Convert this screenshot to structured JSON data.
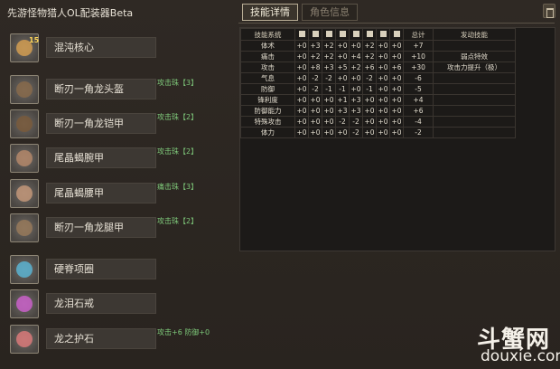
{
  "app": {
    "title": "先游怪物猎人OL配装器Beta"
  },
  "tabs": [
    {
      "label": "技能详情",
      "active": true
    },
    {
      "label": "角色信息",
      "active": false
    }
  ],
  "equipment": [
    {
      "name": "混沌核心",
      "level": "15",
      "note": "",
      "icon": "weapon-icon",
      "color": "#d8a050"
    },
    {
      "name": "断刃一角龙头盔",
      "note": "攻击珠【3】",
      "icon": "helmet-icon",
      "color": "#8a6a4a"
    },
    {
      "name": "断刃一角龙铠甲",
      "note": "攻击珠【2】",
      "icon": "chest-armor-icon",
      "color": "#7a5a3a"
    },
    {
      "name": "尾晶蝎腕甲",
      "note": "攻击珠【2】",
      "icon": "gauntlet-icon",
      "color": "#b88a6a"
    },
    {
      "name": "尾晶蝎腰甲",
      "note": "痛击珠【3】",
      "icon": "waist-armor-icon",
      "color": "#c89a7a"
    },
    {
      "name": "断刃一角龙腿甲",
      "note": "攻击珠【2】",
      "icon": "leg-armor-icon",
      "color": "#9a7a5a"
    },
    {
      "name": "硬脊项圈",
      "note": "",
      "icon": "necklace-icon",
      "color": "#5ab8d8"
    },
    {
      "name": "龙泪石戒",
      "note": "",
      "icon": "ring-icon",
      "color": "#d060d0"
    },
    {
      "name": "龙之护石",
      "note": "攻击+6 防御+0",
      "icon": "amulet-icon",
      "color": "#e07a7a"
    }
  ],
  "skill_table": {
    "headers": [
      "技能系统",
      "",
      "",
      "",
      "",
      "",
      "",
      "",
      "",
      "总计",
      "发动技能"
    ],
    "header_icons": [
      "weapon-icon",
      "helmet-icon",
      "chest-armor-icon",
      "gauntlet-icon",
      "waist-armor-icon",
      "leg-armor-icon",
      "necklace-icon",
      "ring-icon"
    ],
    "rows": [
      {
        "name": "体术",
        "v": [
          "+0",
          "+3",
          "+2",
          "+0",
          "+0",
          "+2",
          "+0",
          "+0"
        ],
        "sum": "+7",
        "skill": ""
      },
      {
        "name": "痛击",
        "v": [
          "+0",
          "+2",
          "+2",
          "+0",
          "+4",
          "+2",
          "+0",
          "+0"
        ],
        "sum": "+10",
        "skill": "弱点特效"
      },
      {
        "name": "攻击",
        "v": [
          "+0",
          "+8",
          "+3",
          "+5",
          "+2",
          "+6",
          "+0",
          "+6"
        ],
        "sum": "+30",
        "skill": "攻击力提升（极）"
      },
      {
        "name": "气息",
        "v": [
          "+0",
          "-2",
          "-2",
          "+0",
          "+0",
          "-2",
          "+0",
          "+0"
        ],
        "sum": "-6",
        "skill": ""
      },
      {
        "name": "防御",
        "v": [
          "+0",
          "-2",
          "-1",
          "-1",
          "+0",
          "-1",
          "+0",
          "+0"
        ],
        "sum": "-5",
        "skill": ""
      },
      {
        "name": "锋利度",
        "v": [
          "+0",
          "+0",
          "+0",
          "+1",
          "+3",
          "+0",
          "+0",
          "+0"
        ],
        "sum": "+4",
        "skill": ""
      },
      {
        "name": "防御能力",
        "v": [
          "+0",
          "+0",
          "+0",
          "+3",
          "+3",
          "+0",
          "+0",
          "+0"
        ],
        "sum": "+6",
        "skill": ""
      },
      {
        "name": "特殊攻击",
        "v": [
          "+0",
          "+0",
          "+0",
          "-2",
          "-2",
          "+0",
          "+0",
          "+0"
        ],
        "sum": "-4",
        "skill": ""
      },
      {
        "name": "体力",
        "v": [
          "+0",
          "+0",
          "+0",
          "+0",
          "-2",
          "+0",
          "+0",
          "+0"
        ],
        "sum": "-2",
        "skill": ""
      }
    ]
  },
  "watermark": {
    "main": "斗蟹网",
    "sub": "douxie.com"
  },
  "colors": {
    "accent_green": "#7ec87a",
    "bg": "#2d2721",
    "table_bg": "#1c1a18"
  }
}
